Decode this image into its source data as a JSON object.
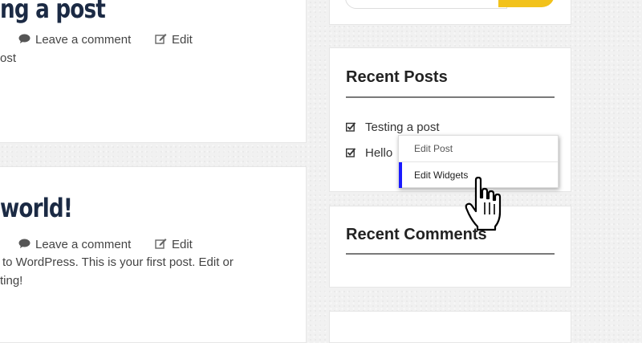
{
  "posts": [
    {
      "title": "ng a post",
      "comment_label": "Leave a comment",
      "edit_label": "Edit",
      "excerpt": [
        "ost"
      ]
    },
    {
      "title": "world!",
      "comment_label": "Leave a comment",
      "edit_label": "Edit",
      "excerpt": [
        "to WordPress. This is your first post. Edit or",
        "ting!"
      ]
    }
  ],
  "sidebar": {
    "search_button_color": "#f2c21b",
    "recent_posts": {
      "title": "Recent Posts",
      "items": [
        "Testing a post",
        "Hello"
      ]
    },
    "recent_comments": {
      "title": "Recent Comments"
    }
  },
  "context_menu": {
    "items": [
      "Edit Post",
      "Edit Widgets"
    ],
    "active_index": 1,
    "active_color": "#1a1aff"
  },
  "cursor": {
    "icon": "hand-pointer-icon"
  }
}
